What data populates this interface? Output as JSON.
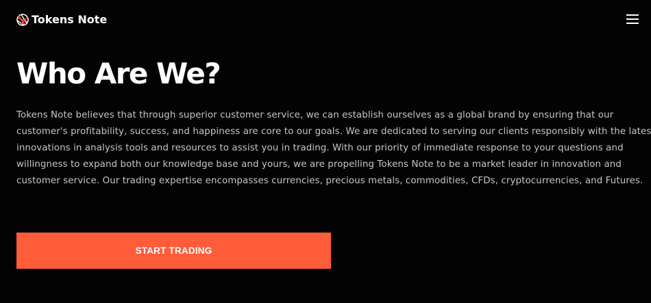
{
  "header": {
    "logo_text": "Tokens Note",
    "logo_icon": "globe-grid-icon",
    "menu_icon": "hamburger-menu-icon"
  },
  "main": {
    "heading": "Who Are We?",
    "description": "Tokens Note believes that through superior customer service, we can establish ourselves as a global brand by ensuring that our customer's profitability, success, and happiness are core to our goals. We are dedicated to serving our clients responsibly with the latest innovations in analysis tools and resources to assist you in trading. With our priority of immediate response to your questions and willingness to expand both our knowledge base and yours, we are propelling Tokens Note to be a market leader in innovation and customer service. Our trading expertise encompasses currencies, precious metals, commodities, CFDs, cryptocurrencies, and Futures.",
    "cta_label": "START TRADING"
  },
  "colors": {
    "background": "#030303",
    "text": "#ffffff",
    "body_text": "#c7c7c7",
    "accent": "#ff5c3a",
    "logo_red": "#e8473a"
  }
}
